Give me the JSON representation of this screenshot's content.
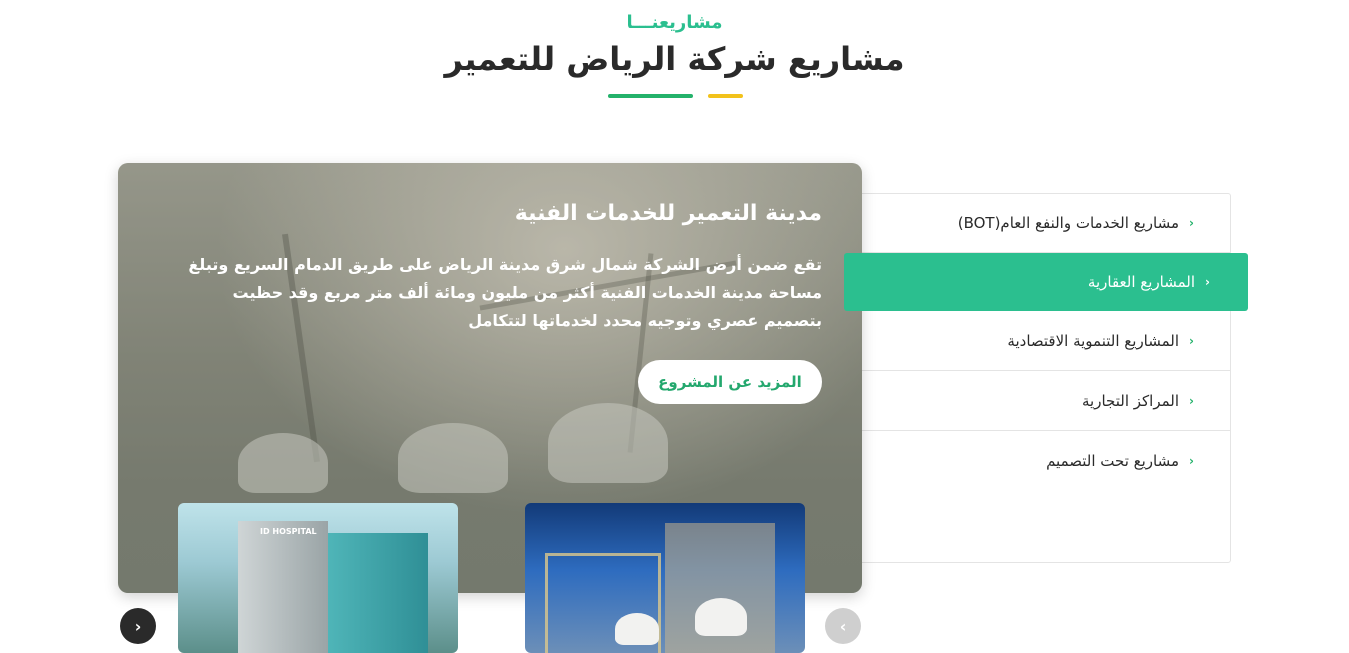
{
  "header": {
    "eyebrow": "مشاريعنـــا",
    "title": "مشاريع شركة الرياض للتعمير"
  },
  "sidebar": {
    "items": [
      {
        "label": "مشاريع الخدمات والنفع العام(BOT)",
        "active": false
      },
      {
        "label": "المشاريع العقارية",
        "active": true
      },
      {
        "label": "المشاريع التنموية الاقتصادية",
        "active": false
      },
      {
        "label": "المراكز التجارية",
        "active": false
      },
      {
        "label": "مشاريع تحت التصميم",
        "active": false
      }
    ],
    "chevron_glyph": "‹"
  },
  "hero": {
    "title": "مدينة التعمير للخدمات الفنية",
    "description": "تقع ضمن أرض الشركة شمال شرق مدينة الرياض على طريق الدمام السريع وتبلغ مساحة مدينة الخدمات الفنية أكثر من مليون ومائة ألف متر مربع وقد حظيت بتصميم عصري وتوجيه محدد لخدماتها لتتكامل",
    "button_label": "المزيد عن المشروع"
  },
  "thumbnails": {
    "hospital_sign": "ID HOSPITAL"
  },
  "carousel": {
    "prev_glyph": "›",
    "next_glyph": "‹"
  },
  "colors": {
    "accent_green": "#2bbf8f",
    "title_green": "#24b26b",
    "title_yellow": "#f2c21b",
    "button_text": "#24a86e"
  }
}
